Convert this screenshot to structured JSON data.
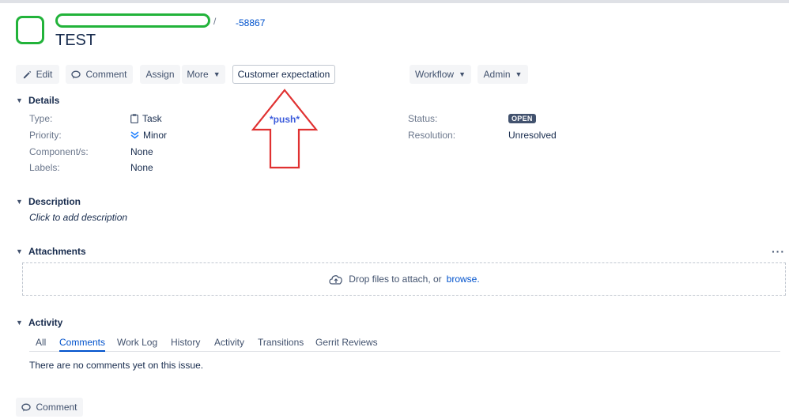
{
  "header": {
    "breadcrumb_separator": "/",
    "issue_key": "-58867",
    "title": "TEST"
  },
  "toolbar": {
    "edit": "Edit",
    "comment": "Comment",
    "assign": "Assign",
    "more": "More",
    "custom_button": "Customer expectation",
    "workflow": "Workflow",
    "admin": "Admin"
  },
  "annotation": {
    "label": "*push*",
    "arrow_color": "#e03131"
  },
  "details": {
    "heading": "Details",
    "type_label": "Type:",
    "type_value": "Task",
    "priority_label": "Priority:",
    "priority_value": "Minor",
    "components_label": "Component/s:",
    "components_value": "None",
    "labels_label": "Labels:",
    "labels_value": "None",
    "status_label": "Status:",
    "status_value": "OPEN",
    "resolution_label": "Resolution:",
    "resolution_value": "Unresolved"
  },
  "description": {
    "heading": "Description",
    "placeholder": "Click to add description"
  },
  "attachments": {
    "heading": "Attachments",
    "more_icon": "···",
    "drop_text": "Drop files to attach, or",
    "browse_link": "browse."
  },
  "activity": {
    "heading": "Activity",
    "tabs": [
      "All",
      "Comments",
      "Work Log",
      "History",
      "Activity",
      "Transitions",
      "Gerrit Reviews"
    ],
    "active_tab": "Comments",
    "empty_message": "There are no comments yet on this issue."
  },
  "footer": {
    "comment_button": "Comment"
  },
  "colors": {
    "link": "#0052cc",
    "redaction_marker": "#22b33a",
    "status_badge": "#42526e"
  }
}
